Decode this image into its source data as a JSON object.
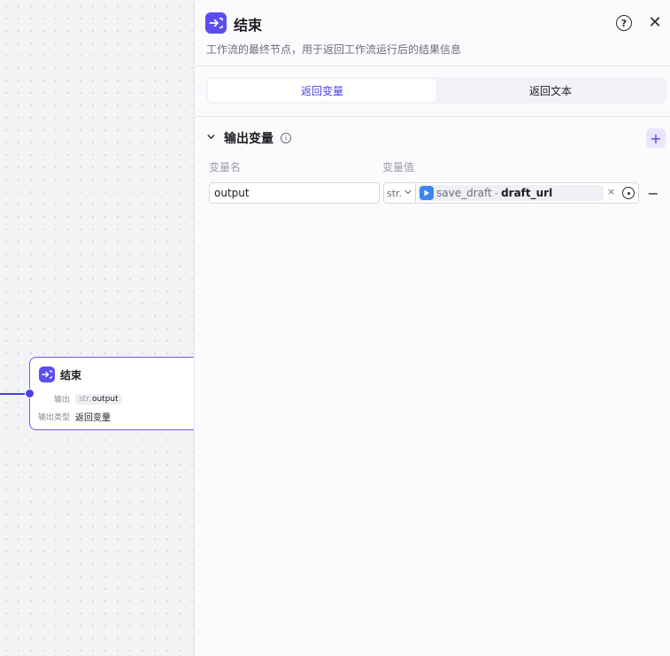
{
  "canvas_node": {
    "title": "结束",
    "rows": [
      {
        "key": "输出",
        "type_prefix": "str.",
        "value": "output"
      },
      {
        "key": "输出类型",
        "value": "返回变量"
      }
    ]
  },
  "panel": {
    "title": "结束",
    "description": "工作流的最终节点，用于返回工作流运行后的结果信息",
    "help_glyph": "?",
    "close_glyph": "✕",
    "tabs": [
      {
        "label": "返回变量",
        "active": true
      },
      {
        "label": "返回文本",
        "active": false
      }
    ],
    "output_section": {
      "title": "输出变量",
      "info_glyph": "i",
      "add_glyph": "+",
      "col_name": "变量名",
      "col_value": "变量值",
      "rows": [
        {
          "name": "output",
          "type": "str.",
          "ref_node": "save_draft",
          "ref_separator": "-",
          "ref_var": "draft_url",
          "clear_glyph": "×",
          "remove_glyph": "−"
        }
      ]
    }
  },
  "colors": {
    "accent": "#4e40e5",
    "node_icon": "#5b4ef0",
    "ref_icon": "#3a86f0"
  }
}
